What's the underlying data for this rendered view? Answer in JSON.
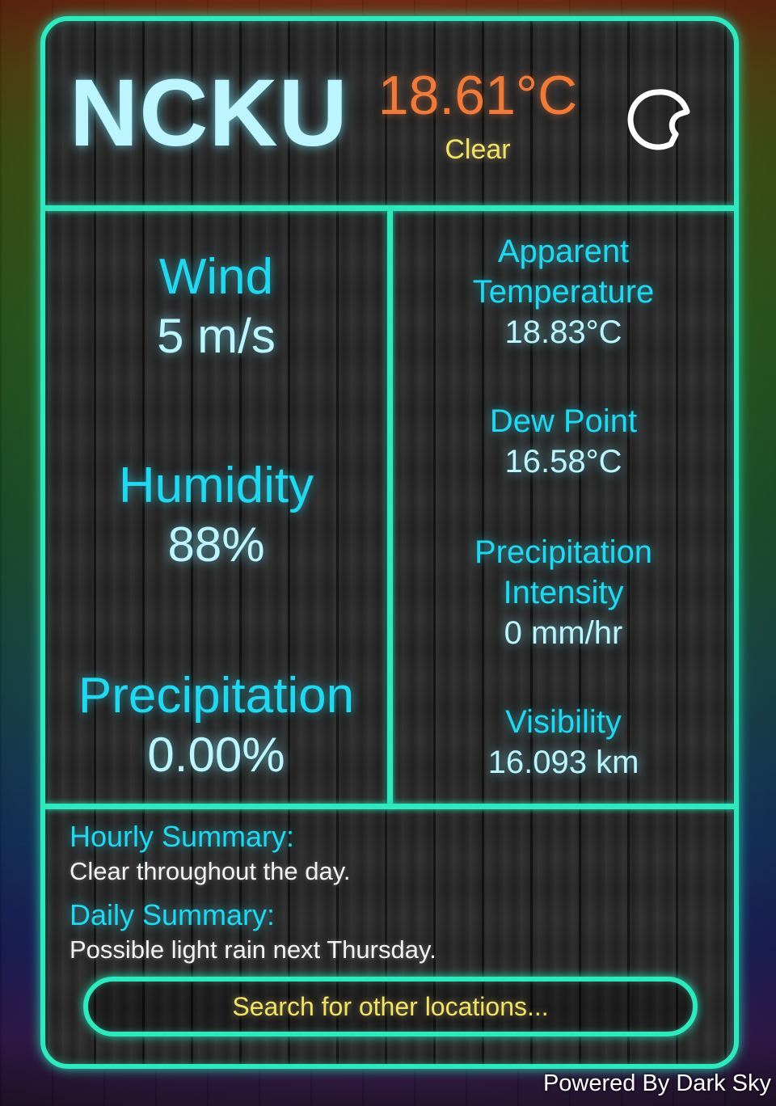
{
  "header": {
    "city": "NCKU",
    "temperature": "18.61°C",
    "condition": "Clear",
    "icon": "clear-night-moon-icon"
  },
  "left_stats": [
    {
      "label": "Wind",
      "value": "5 m/s"
    },
    {
      "label": "Humidity",
      "value": "88%"
    },
    {
      "label": "Precipitation",
      "value": "0.00%"
    }
  ],
  "right_stats": {
    "apparent": {
      "label_line1": "Apparent",
      "label_line2": "Temperature",
      "value": "18.83°C"
    },
    "dew_point": {
      "label": "Dew Point",
      "value": "16.58°C"
    },
    "precip_intensity": {
      "label_line1": "Precipitation",
      "label_line2": "Intensity",
      "value": "0 mm/hr"
    },
    "visibility": {
      "label": "Visibility",
      "value": "16.093 km"
    }
  },
  "summary": {
    "hourly_title": "Hourly Summary:",
    "hourly_text": "Clear throughout the day.",
    "daily_title": "Daily Summary:",
    "daily_text": "Possible light rain next Thursday."
  },
  "search": {
    "label": "Search for other locations..."
  },
  "footer": {
    "text": "Powered By Dark Sky"
  },
  "colors": {
    "accent": "#2fe8bd",
    "label": "#22d8f0",
    "value": "#bdf5ff",
    "temperature": "#f07a3a",
    "highlight": "#f3e26a"
  }
}
